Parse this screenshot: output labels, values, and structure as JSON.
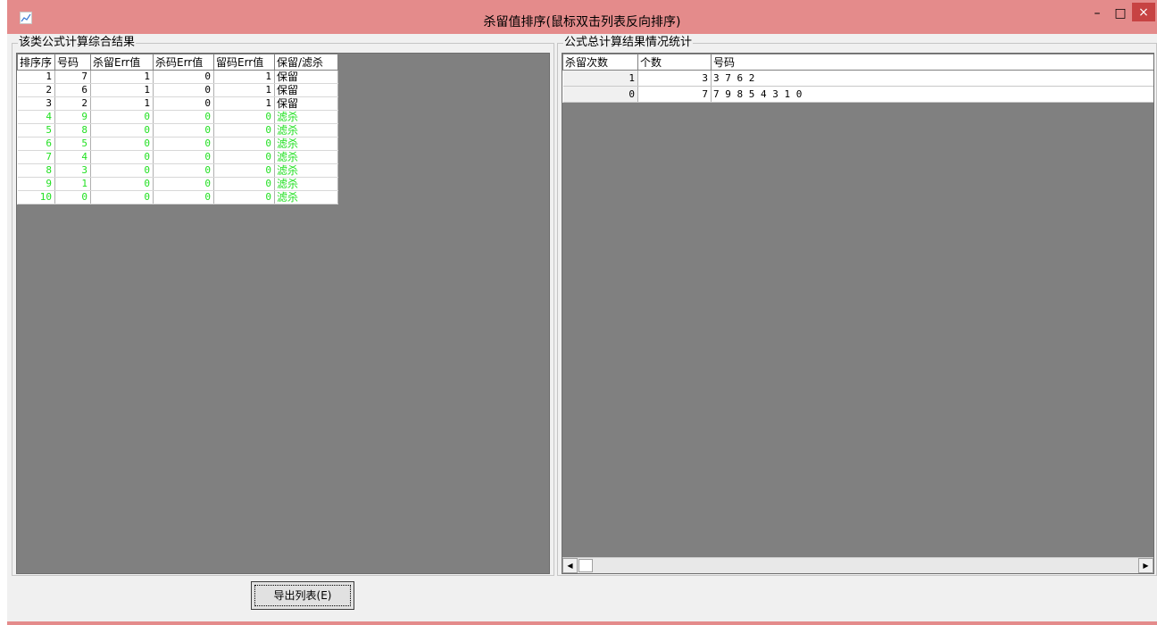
{
  "window": {
    "title": "杀留值排序(鼠标双击列表反向排序)"
  },
  "controls": {
    "minimize": "–",
    "maximize": "□",
    "close": "×"
  },
  "left_panel": {
    "title": "该类公式计算综合结果",
    "columns": [
      "排序序",
      "号码",
      "杀留Err值",
      "杀码Err值",
      "留码Err值",
      "保留/滤杀"
    ],
    "rows": [
      [
        "1",
        "7",
        "1",
        "0",
        "1",
        "保留"
      ],
      [
        "2",
        "6",
        "1",
        "0",
        "1",
        "保留"
      ],
      [
        "3",
        "2",
        "1",
        "0",
        "1",
        "保留"
      ],
      [
        "4",
        "9",
        "0",
        "0",
        "0",
        "滤杀"
      ],
      [
        "5",
        "8",
        "0",
        "0",
        "0",
        "滤杀"
      ],
      [
        "6",
        "5",
        "0",
        "0",
        "0",
        "滤杀"
      ],
      [
        "7",
        "4",
        "0",
        "0",
        "0",
        "滤杀"
      ],
      [
        "8",
        "3",
        "0",
        "0",
        "0",
        "滤杀"
      ],
      [
        "9",
        "1",
        "0",
        "0",
        "0",
        "滤杀"
      ],
      [
        "10",
        "0",
        "0",
        "0",
        "0",
        "滤杀"
      ]
    ]
  },
  "right_panel": {
    "title": "公式总计算结果情况统计",
    "columns": [
      "杀留次数",
      "个数",
      "号码"
    ],
    "rows": [
      [
        "1",
        "3",
        "3 7 6 2"
      ],
      [
        "0",
        "7",
        "7 9 8 5 4 3 1 0"
      ]
    ]
  },
  "scrollbar": {
    "left_arrow": "◀",
    "right_arrow": "▶"
  },
  "export_button": {
    "label": "导出列表(E)"
  },
  "colors": {
    "titlebar": "#e48b8b",
    "close": "#c74343",
    "kill_text": "#22e022",
    "list_bg": "#808080"
  }
}
